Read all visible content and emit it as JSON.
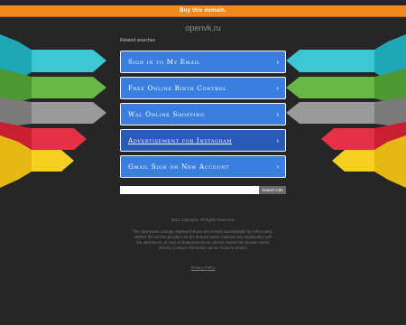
{
  "topbar": {
    "label": "Buy this domain."
  },
  "site": {
    "domain": "openvk.ru"
  },
  "related": {
    "title": "Related searches",
    "links": [
      {
        "label": "Sign in to My Email"
      },
      {
        "label": "Free Online Birth Control"
      },
      {
        "label": "Wal Online Shopping"
      },
      {
        "label": "Advertisement for Instagram"
      },
      {
        "label": "Gmail Sign on New Account"
      }
    ]
  },
  "search": {
    "value": "",
    "button_label": "Search Ads"
  },
  "footer": {
    "copyright": "2021 Copyright. All Rights Reserved.",
    "disclaimer": "The Sponsored Listings displayed above are served automatically by a third party. Neither the service provider nor the domain owner maintain any relationship with the advertisers. In case of trademark issues please contact the domain owner directly (contact information can be found in whois).",
    "privacy_label": "Privacy Policy"
  },
  "colors": {
    "topbar": "#f08a1e",
    "button": "#3a7fe0",
    "button_active": "#2b59b7",
    "background": "#262626",
    "ribbon_teal": "#2ab7c6",
    "ribbon_green": "#5aa83d",
    "ribbon_gray": "#8c8c8c",
    "ribbon_red": "#e0283d",
    "ribbon_yellow": "#f2c81b"
  }
}
